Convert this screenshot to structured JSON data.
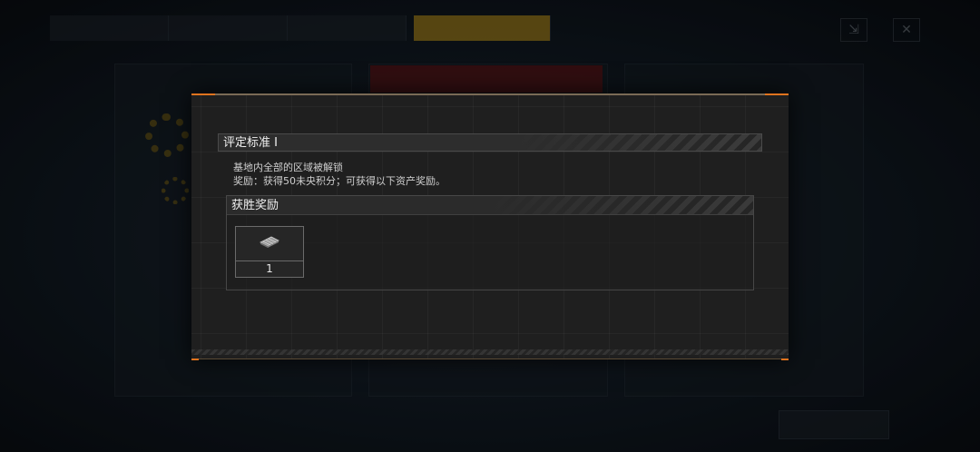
{
  "criteria": {
    "title": "评定标准 I",
    "description": "基地内全部的区域被解锁",
    "reward_text": "奖励：获得50未央积分；可获得以下资产奖励。"
  },
  "rewards": {
    "title": "获胜奖励",
    "items": [
      {
        "icon": "chip-icon",
        "count": "1"
      }
    ]
  },
  "colors": {
    "accent": "#e0731e",
    "modal_bg": "#1f1f1f",
    "active_tab": "#c79a16"
  }
}
